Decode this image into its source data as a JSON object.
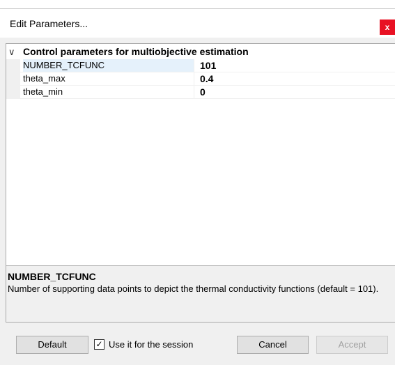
{
  "window": {
    "title": "Edit  Parameters...",
    "close_glyph": "x",
    "close_color": "#e81123"
  },
  "grid": {
    "category": {
      "chevron": "∨",
      "label": "Control parameters for multiobjective estimation",
      "expanded": true
    },
    "properties": [
      {
        "name": "NUMBER_TCFUNC",
        "value": "101",
        "selected": true
      },
      {
        "name": "theta_max",
        "value": "0.4",
        "selected": false
      },
      {
        "name": "theta_min",
        "value": "0",
        "selected": false
      }
    ]
  },
  "description": {
    "title": "NUMBER_TCFUNC",
    "text": "Number of supporting data points to depict the thermal conductivity functions (default = 101)."
  },
  "footer": {
    "default_label": "Default",
    "checkbox_label": "Use it for the session",
    "checkbox_checked": true,
    "checkbox_glyph": "✓",
    "cancel_label": "Cancel",
    "accept_label": "Accept",
    "accept_enabled": false
  },
  "colors": {
    "selected_row": "#e5f1fb",
    "panel_bg": "#f0f0f0"
  }
}
